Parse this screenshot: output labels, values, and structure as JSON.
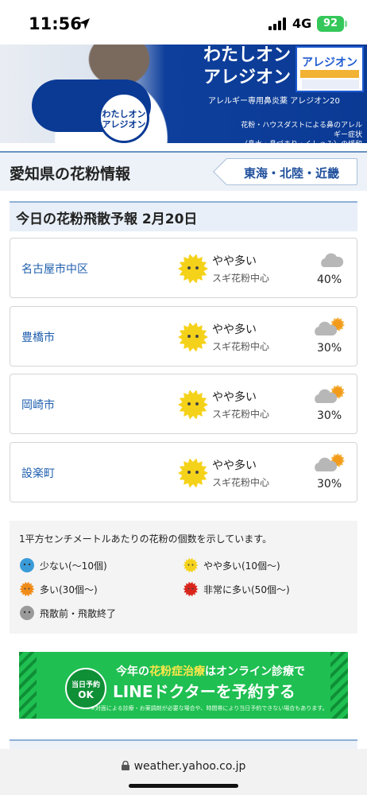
{
  "status_bar": {
    "time": "11:56",
    "network": "4G",
    "battery": "92"
  },
  "ad_banner": {
    "badge": "わたしオン\nアレジオン",
    "headline": "わたしオン\nアレジオン",
    "product_name": "アレジオン",
    "caption": "アレルギー専用鼻炎薬 アレジオン20",
    "fineprint": "花粉・ハウスダストによる鼻のアレルギー症状\n（鼻水・鼻づまり・くしゃみ）の緩和に"
  },
  "region": {
    "title": "愛知県の花粉情報",
    "tab_label": "東海・北陸・近畿"
  },
  "forecast": {
    "title": "今日の花粉飛散予報 2月20日",
    "cities": [
      {
        "name": "名古屋市中区",
        "level": "やや多い",
        "source": "スギ花粉中心",
        "precip": "40%",
        "weather": "cloudy-icon"
      },
      {
        "name": "豊橋市",
        "level": "やや多い",
        "source": "スギ花粉中心",
        "precip": "30%",
        "weather": "cloudy-sunny-icon"
      },
      {
        "name": "岡崎市",
        "level": "やや多い",
        "source": "スギ花粉中心",
        "precip": "30%",
        "weather": "cloudy-sunny-icon"
      },
      {
        "name": "設楽町",
        "level": "やや多い",
        "source": "スギ花粉中心",
        "precip": "30%",
        "weather": "cloudy-sunny-icon"
      }
    ]
  },
  "legend": {
    "description": "1平方センチメートルあたりの花粉の個数を示しています。",
    "items": [
      {
        "label": "少ない(〜10個)",
        "icon": "pollen-low-icon",
        "color": "#3a9bd9"
      },
      {
        "label": "やや多い(10個〜)",
        "icon": "pollen-moderate-icon",
        "color": "#f5d21a"
      },
      {
        "label": "多い(30個〜)",
        "icon": "pollen-high-icon",
        "color": "#f08c1a"
      },
      {
        "label": "非常に多い(50個〜)",
        "icon": "pollen-very-high-icon",
        "color": "#d9261c"
      },
      {
        "label": "飛散前・飛散終了",
        "icon": "pollen-none-icon",
        "color": "#9a9a9a"
      }
    ]
  },
  "line_ad": {
    "badge_top": "当日予約",
    "badge_ok": "OK",
    "line1_pre": "今年の",
    "line1_highlight": "花粉症治療",
    "line1_post": "はオンライン診療で",
    "line2": "LINEドクターを予約する",
    "note": "※対面による診療・お薬調剤が必要な場合や、時間帯により当日予約できない場合もあります。"
  },
  "browser": {
    "url": "weather.yahoo.co.jp"
  },
  "colors": {
    "accent": "#1f5fae",
    "header_bg": "#edf2f8",
    "line_green": "#1fbf52"
  }
}
